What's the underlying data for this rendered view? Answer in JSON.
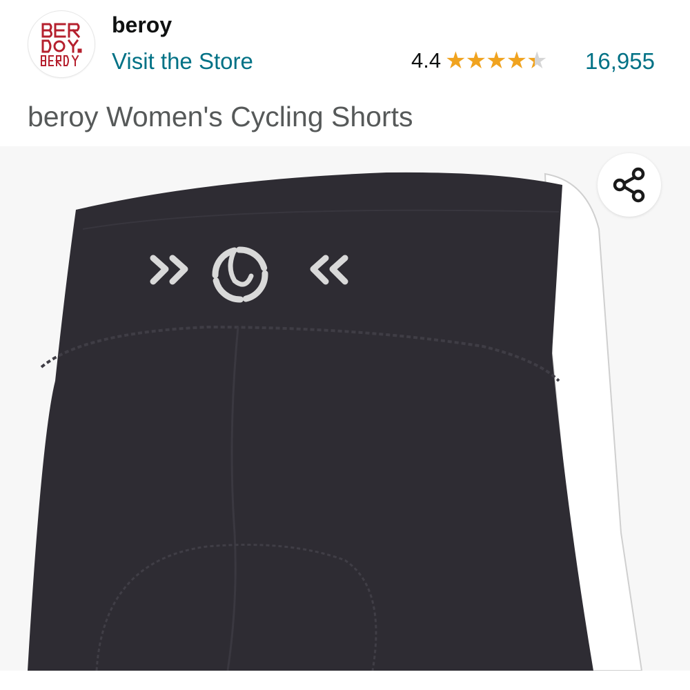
{
  "header": {
    "brand_name": "beroy",
    "visit_store_label": "Visit the Store",
    "rating": "4.4",
    "rating_value": 4.4,
    "rating_max": 5,
    "review_count": "16,955",
    "star_color": "#f0a31f",
    "link_color": "#007185"
  },
  "logo": {
    "icon": "beroy-logo-icon",
    "color": "#b5202e"
  },
  "product": {
    "title": "beroy Women's Cycling Shorts"
  },
  "image": {
    "icon": "share-icon",
    "fabric_color": "#2e2c33",
    "panel_color": "#ffffff"
  }
}
